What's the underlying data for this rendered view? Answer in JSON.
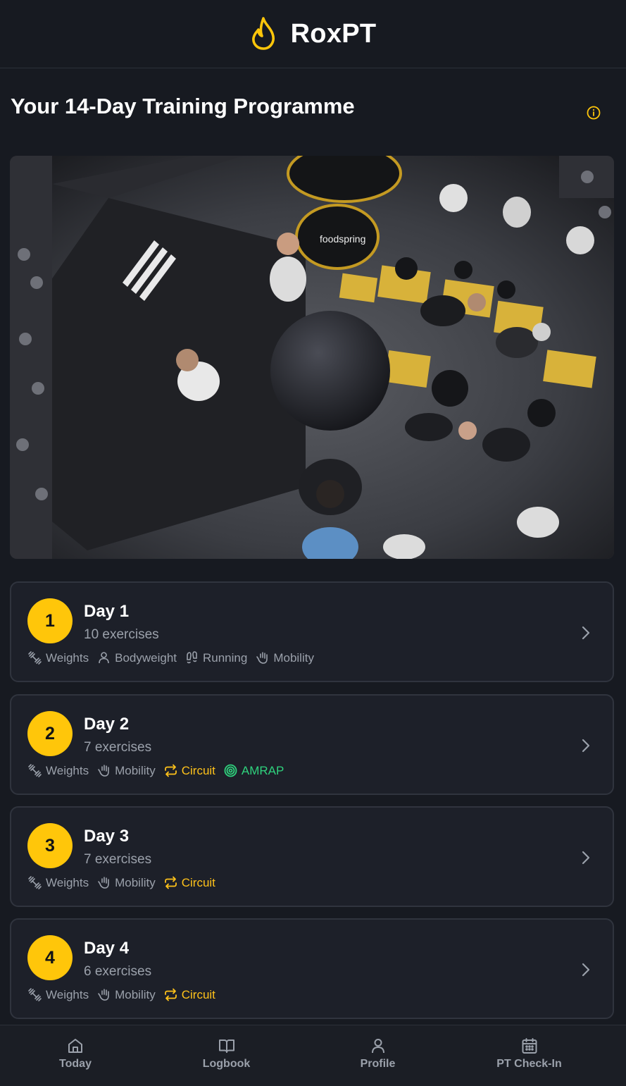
{
  "app": {
    "name": "RoxPT",
    "logo_icon": "flame-icon"
  },
  "colors": {
    "accent": "#ffc60a",
    "circuit": "#ffc21a",
    "amrap": "#2fd27d",
    "muted": "#9ba1ab",
    "background": "#171a21",
    "card": "#1d2029"
  },
  "page": {
    "title": "Your 14-Day Training Programme",
    "info_icon": "info-icon"
  },
  "hero": {
    "image": "hyrox-gym-overhead-photo"
  },
  "days": [
    {
      "number": "1",
      "title": "Day 1",
      "subtitle": "10 exercises",
      "tags": [
        {
          "label": "Weights",
          "icon": "weights-icon"
        },
        {
          "label": "Bodyweight",
          "icon": "person-icon"
        },
        {
          "label": "Running",
          "icon": "footprints-icon"
        },
        {
          "label": "Mobility",
          "icon": "stretch-hand-icon"
        }
      ]
    },
    {
      "number": "2",
      "title": "Day 2",
      "subtitle": "7 exercises",
      "tags": [
        {
          "label": "Weights",
          "icon": "weights-icon"
        },
        {
          "label": "Mobility",
          "icon": "stretch-hand-icon"
        },
        {
          "label": "Circuit",
          "icon": "repeat-icon"
        },
        {
          "label": "AMRAP",
          "icon": "target-icon"
        }
      ]
    },
    {
      "number": "3",
      "title": "Day 3",
      "subtitle": "7 exercises",
      "tags": [
        {
          "label": "Weights",
          "icon": "weights-icon"
        },
        {
          "label": "Mobility",
          "icon": "stretch-hand-icon"
        },
        {
          "label": "Circuit",
          "icon": "repeat-icon"
        }
      ]
    },
    {
      "number": "4",
      "title": "Day 4",
      "subtitle": "6 exercises",
      "tags": [
        {
          "label": "Weights",
          "icon": "weights-icon"
        },
        {
          "label": "Mobility",
          "icon": "stretch-hand-icon"
        },
        {
          "label": "Circuit",
          "icon": "repeat-icon"
        }
      ]
    }
  ],
  "nav": [
    {
      "label": "Today",
      "icon": "home-icon"
    },
    {
      "label": "Logbook",
      "icon": "book-icon"
    },
    {
      "label": "Profile",
      "icon": "user-icon"
    },
    {
      "label": "PT Check-In",
      "icon": "calendar-icon"
    }
  ]
}
